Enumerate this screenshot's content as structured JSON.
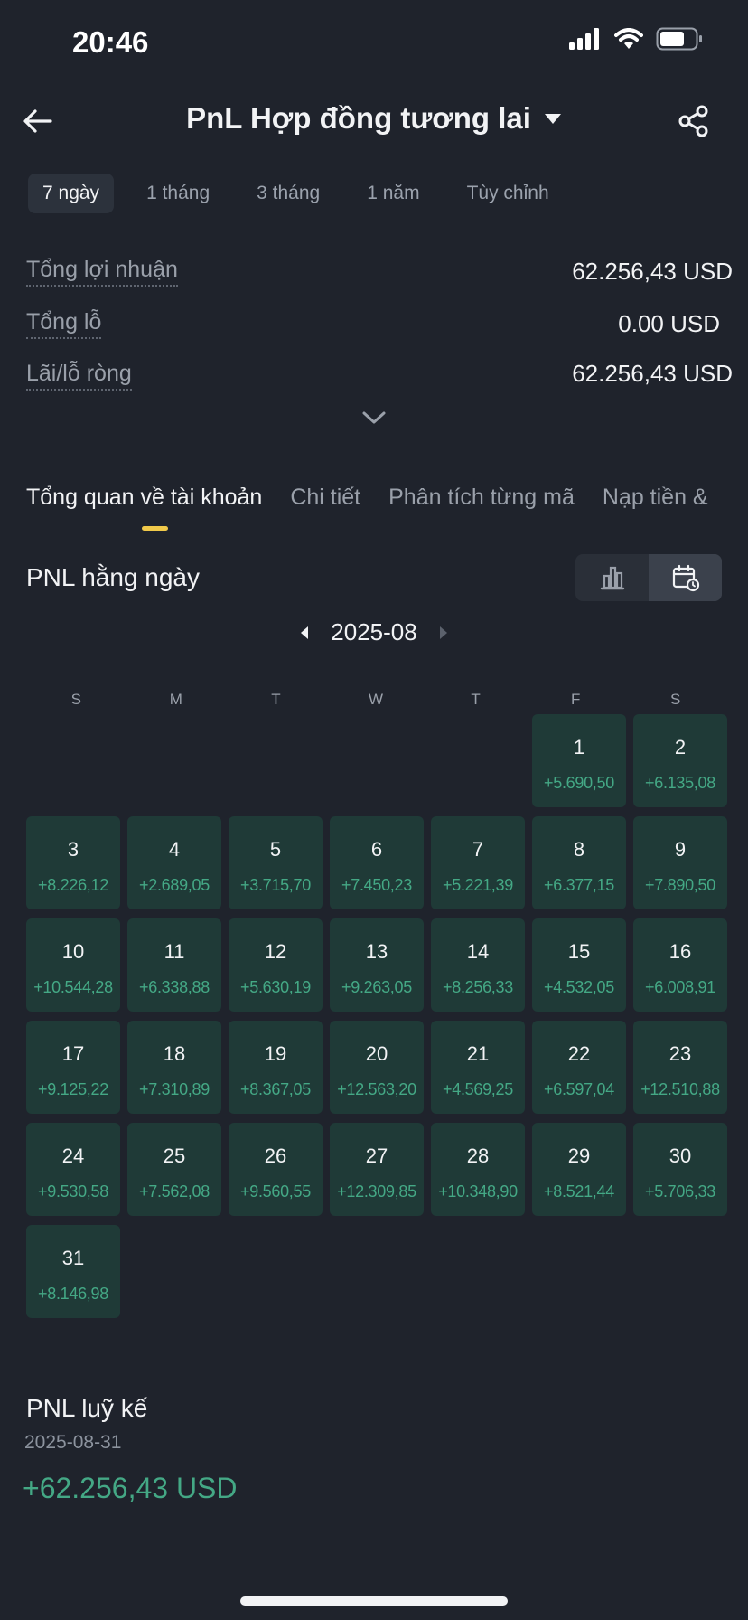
{
  "status": {
    "time": "20:46"
  },
  "header": {
    "title": "PnL Hợp đồng tương lai"
  },
  "periods": [
    "7 ngày",
    "1 tháng",
    "3 tháng",
    "1 năm",
    "Tùy chỉnh"
  ],
  "summary": {
    "rows": [
      {
        "label": "Tổng lợi nhuận",
        "value": "62.256,43 USD"
      },
      {
        "label": "Tổng lỗ",
        "value": "0.00 USD"
      },
      {
        "label": "Lãi/lỗ ròng",
        "value": "62.256,43 USD"
      }
    ]
  },
  "tabs": [
    "Tổng quan về tài khoản",
    "Chi tiết",
    "Phân tích từng mã",
    "Nạp tiền &"
  ],
  "daily": {
    "title": "PNL hằng ngày",
    "month": "2025-08",
    "weekdays": [
      "S",
      "M",
      "T",
      "W",
      "T",
      "F",
      "S"
    ],
    "leading_blank_days": 5,
    "days": [
      {
        "day": "1",
        "pnl": "+5.690,50"
      },
      {
        "day": "2",
        "pnl": "+6.135,08"
      },
      {
        "day": "3",
        "pnl": "+8.226,12"
      },
      {
        "day": "4",
        "pnl": "+2.689,05"
      },
      {
        "day": "5",
        "pnl": "+3.715,70"
      },
      {
        "day": "6",
        "pnl": "+7.450,23"
      },
      {
        "day": "7",
        "pnl": "+5.221,39"
      },
      {
        "day": "8",
        "pnl": "+6.377,15"
      },
      {
        "day": "9",
        "pnl": "+7.890,50"
      },
      {
        "day": "10",
        "pnl": "+10.544,28"
      },
      {
        "day": "11",
        "pnl": "+6.338,88"
      },
      {
        "day": "12",
        "pnl": "+5.630,19"
      },
      {
        "day": "13",
        "pnl": "+9.263,05"
      },
      {
        "day": "14",
        "pnl": "+8.256,33"
      },
      {
        "day": "15",
        "pnl": "+4.532,05"
      },
      {
        "day": "16",
        "pnl": "+6.008,91"
      },
      {
        "day": "17",
        "pnl": "+9.125,22"
      },
      {
        "day": "18",
        "pnl": "+7.310,89"
      },
      {
        "day": "19",
        "pnl": "+8.367,05"
      },
      {
        "day": "20",
        "pnl": "+12.563,20"
      },
      {
        "day": "21",
        "pnl": "+4.569,25"
      },
      {
        "day": "22",
        "pnl": "+6.597,04"
      },
      {
        "day": "23",
        "pnl": "+12.510,88"
      },
      {
        "day": "24",
        "pnl": "+9.530,58"
      },
      {
        "day": "25",
        "pnl": "+7.562,08"
      },
      {
        "day": "26",
        "pnl": "+9.560,55"
      },
      {
        "day": "27",
        "pnl": "+12.309,85"
      },
      {
        "day": "28",
        "pnl": "+10.348,90"
      },
      {
        "day": "29",
        "pnl": "+8.521,44"
      },
      {
        "day": "30",
        "pnl": "+5.706,33"
      },
      {
        "day": "31",
        "pnl": "+8.146,98"
      }
    ]
  },
  "cumulative": {
    "title": "PNL luỹ kế",
    "date": "2025-08-31",
    "value": "+62.256,43 USD"
  },
  "colors": {
    "background": "#1f232c",
    "cell": "#1f3a37",
    "profit": "#44a885",
    "accent": "#f0c94a"
  },
  "icons": [
    "back-arrow-icon",
    "caret-down-icon",
    "share-icon",
    "chevron-down-icon",
    "bar-chart-icon",
    "calendar-icon",
    "triangle-left-icon",
    "triangle-right-icon",
    "signal-icon",
    "wifi-icon",
    "battery-icon"
  ]
}
